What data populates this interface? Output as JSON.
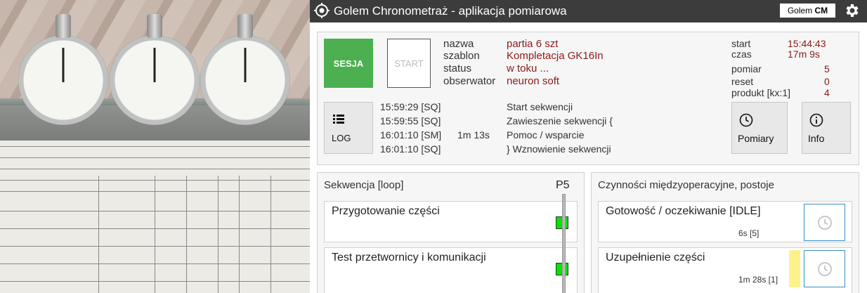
{
  "window": {
    "title": "Golem Chronometraż - aplikacja pomiarowa",
    "badge_prefix": "Golem",
    "badge_suffix": "CM"
  },
  "session": {
    "sesja_label": "SESJA",
    "start_label": "START",
    "fields": [
      {
        "label": "nazwa",
        "value": "partia 6 szt"
      },
      {
        "label": "szablon",
        "value": "Kompletacja  GK16In"
      },
      {
        "label": "status",
        "value": "w toku ..."
      },
      {
        "label": "obserwator",
        "value": "neuron soft"
      }
    ],
    "stats": [
      {
        "label": "start",
        "value": "15:44:43"
      },
      {
        "label": "czas",
        "value": "17m 9s"
      },
      {
        "label": "pomiar",
        "value": "5"
      },
      {
        "label": "reset",
        "value": "0"
      },
      {
        "label": "produkt [kx:1]",
        "value": "4"
      }
    ]
  },
  "log": {
    "button_label": "LOG",
    "entries": [
      {
        "time": "15:59:29 [SQ]",
        "extra": "",
        "text": "Start sekwencji"
      },
      {
        "time": "15:59:55 [SQ]",
        "extra": "",
        "text": "Zawieszenie sekwencji {"
      },
      {
        "time": "16:01:10 [SM]",
        "extra": "1m 13s",
        "text": "Pomoc / wsparcie"
      },
      {
        "time": "16:01:10 [SQ]",
        "extra": "",
        "text": "} Wznowienie sekwencji"
      }
    ]
  },
  "buttons": {
    "pomiary": "Pomiary",
    "info": "Info"
  },
  "sequence": {
    "title": "Sekwencja [loop]",
    "marker": "P5",
    "items": [
      {
        "label": "Przygotowanie części"
      },
      {
        "label": "Test przetwornicy i komunikacji"
      }
    ]
  },
  "idle": {
    "title": "Czynności międzyoperacyjne, postoje",
    "items": [
      {
        "label": "Gotowość / oczekiwanie [IDLE]",
        "duration": "6s [5]"
      },
      {
        "label": "Uzupełnienie części",
        "duration": "1m 28s [1]"
      }
    ]
  },
  "colors": {
    "accent_green": "#4caf50",
    "value_red": "#8b1a1a",
    "status_green": "#00e600",
    "highlight_yellow": "#fdf28a",
    "clock_border": "#3a8fc4"
  }
}
